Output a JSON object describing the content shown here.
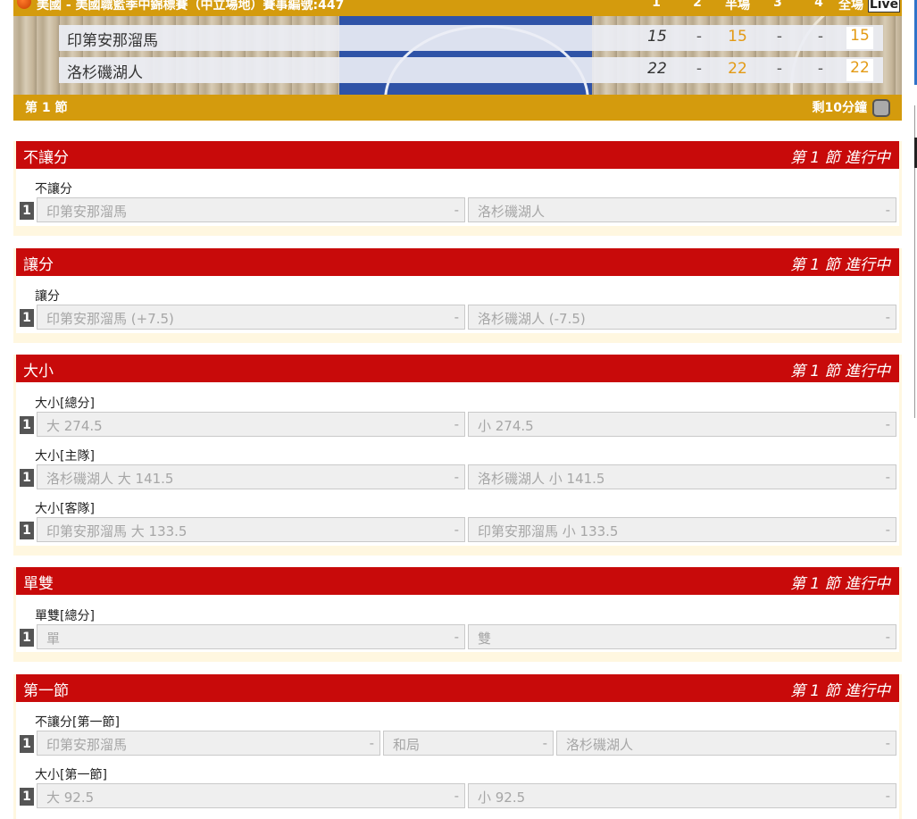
{
  "header": {
    "title": "美國 - 美國職籃季中錦標賽（中立場地）賽事編號:447",
    "columns": [
      "1",
      "2",
      "半場",
      "3",
      "4",
      "全場"
    ],
    "live_label": "Live",
    "teams": [
      {
        "name": "印第安那溜馬",
        "q1": "15",
        "q2": "-",
        "half": "15",
        "q3": "-",
        "q4": "-",
        "full": "15"
      },
      {
        "name": "洛杉磯湖人",
        "q1": "22",
        "q2": "-",
        "half": "22",
        "q3": "-",
        "q4": "-",
        "full": "22"
      }
    ],
    "period": "第 1 節",
    "remaining": "剩10分鐘"
  },
  "sections": [
    {
      "name": "不讓分",
      "status": "第 1 節 進行中",
      "markets": [
        {
          "label": "不讓分",
          "num": "1",
          "cells": [
            {
              "label": "印第安那溜馬",
              "odd": "-"
            },
            {
              "label": "洛杉磯湖人",
              "odd": "-"
            }
          ]
        }
      ]
    },
    {
      "name": "讓分",
      "status": "第 1 節 進行中",
      "markets": [
        {
          "label": "讓分",
          "num": "1",
          "cells": [
            {
              "label": "印第安那溜馬 (+7.5)",
              "odd": "-"
            },
            {
              "label": "洛杉磯湖人 (-7.5)",
              "odd": "-"
            }
          ]
        }
      ]
    },
    {
      "name": "大小",
      "status": "第 1 節 進行中",
      "markets": [
        {
          "label": "大小[總分]",
          "num": "1",
          "cells": [
            {
              "label": "大 274.5",
              "odd": "-"
            },
            {
              "label": "小 274.5",
              "odd": "-"
            }
          ]
        },
        {
          "label": "大小[主隊]",
          "num": "1",
          "cells": [
            {
              "label": "洛杉磯湖人 大 141.5",
              "odd": "-"
            },
            {
              "label": "洛杉磯湖人 小 141.5",
              "odd": "-"
            }
          ]
        },
        {
          "label": "大小[客隊]",
          "num": "1",
          "cells": [
            {
              "label": "印第安那溜馬 大 133.5",
              "odd": "-"
            },
            {
              "label": "印第安那溜馬 小 133.5",
              "odd": "-"
            }
          ]
        }
      ]
    },
    {
      "name": "單雙",
      "status": "第 1 節 進行中",
      "markets": [
        {
          "label": "單雙[總分]",
          "num": "1",
          "cells": [
            {
              "label": "單",
              "odd": "-"
            },
            {
              "label": "雙",
              "odd": "-"
            }
          ]
        }
      ]
    },
    {
      "name": "第一節",
      "status": "第 1 節 進行中",
      "markets": [
        {
          "label": "不讓分[第一節]",
          "num": "1",
          "cells": [
            {
              "label": "印第安那溜馬",
              "odd": "-"
            },
            {
              "label": "和局",
              "odd": "-"
            },
            {
              "label": "洛杉磯湖人",
              "odd": "-"
            }
          ]
        },
        {
          "label": "大小[第一節]",
          "num": "1",
          "cells": [
            {
              "label": "大 92.5",
              "odd": "-"
            },
            {
              "label": "小 92.5",
              "odd": "-"
            }
          ]
        }
      ]
    }
  ],
  "colors": {
    "header_gold": "#d49b0d",
    "section_red": "#c80a0a",
    "score_orange": "#e39a14",
    "section_bg": "#fff7e0"
  }
}
